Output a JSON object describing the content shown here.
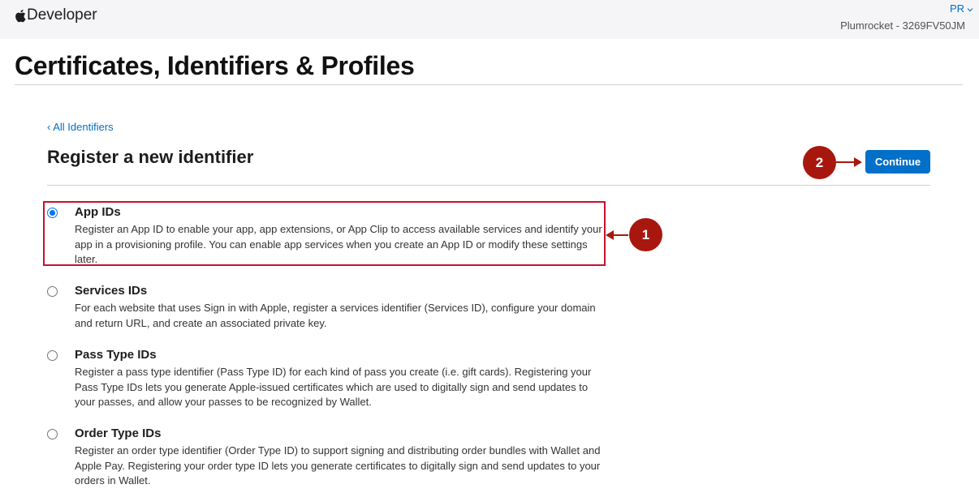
{
  "header": {
    "brand_name": "Developer",
    "account_initials": "PR",
    "team_name": "Plumrocket - 3269FV50JM"
  },
  "page": {
    "title": "Certificates, Identifiers & Profiles"
  },
  "nav": {
    "back_link": "‹ All Identifiers"
  },
  "section": {
    "title": "Register a new identifier",
    "continue_label": "Continue"
  },
  "options": [
    {
      "title": "App IDs",
      "description": "Register an App ID to enable your app, app extensions, or App Clip to access available services and identify your app in a provisioning profile. You can enable app services when you create an App ID or modify these settings later.",
      "selected": true
    },
    {
      "title": "Services IDs",
      "description": "For each website that uses Sign in with Apple, register a services identifier (Services ID), configure your domain and return URL, and create an associated private key.",
      "selected": false
    },
    {
      "title": "Pass Type IDs",
      "description": "Register a pass type identifier (Pass Type ID) for each kind of pass you create (i.e. gift cards). Registering your Pass Type IDs lets you generate Apple-issued certificates which are used to digitally sign and send updates to your passes, and allow your passes to be recognized by Wallet.",
      "selected": false
    },
    {
      "title": "Order Type IDs",
      "description": "Register an order type identifier (Order Type ID) to support signing and distributing order bundles with Wallet and Apple Pay. Registering your order type ID lets you generate certificates to digitally sign and send updates to your orders in Wallet.",
      "selected": false
    }
  ],
  "annotations": {
    "step1_label": "1",
    "step2_label": "2",
    "marker_color": "#a8170e",
    "highlight_color": "#c8102e"
  },
  "colors": {
    "accent": "#0070c9",
    "topbar_bg": "#f5f5f7"
  }
}
